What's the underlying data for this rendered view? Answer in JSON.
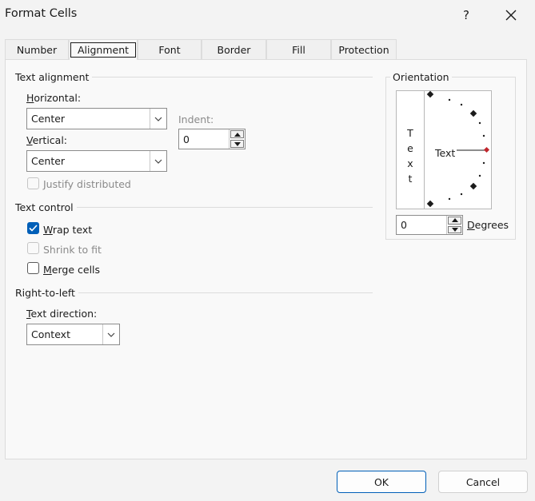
{
  "window": {
    "title": "Format Cells",
    "help_label": "?"
  },
  "tabs": [
    {
      "label": "Number",
      "active": false
    },
    {
      "label": "Alignment",
      "active": true
    },
    {
      "label": "Font",
      "active": false
    },
    {
      "label": "Border",
      "active": false
    },
    {
      "label": "Fill",
      "active": false
    },
    {
      "label": "Protection",
      "active": false
    }
  ],
  "text_alignment": {
    "group_label": "Text alignment",
    "horizontal_label_u": "H",
    "horizontal_label_rest": "orizontal:",
    "horizontal_value": "Center",
    "vertical_label_u": "V",
    "vertical_label_rest": "ertical:",
    "vertical_value": "Center",
    "indent_label": "Indent:",
    "indent_value": "0",
    "justify_distributed_label": "Justify distributed"
  },
  "text_control": {
    "group_label": "Text control",
    "wrap_text_u": "W",
    "wrap_text_rest": "rap text",
    "wrap_text_checked": true,
    "shrink_to_fit_label": "Shrink to fit",
    "merge_cells_u": "M",
    "merge_cells_rest": "erge cells",
    "merge_cells_checked": false
  },
  "right_to_left": {
    "group_label": "Right-to-left",
    "text_direction_u": "T",
    "text_direction_rest": "ext direction:",
    "text_direction_value": "Context"
  },
  "orientation": {
    "group_label": "Orientation",
    "vertical_text": [
      "T",
      "e",
      "x",
      "t"
    ],
    "dial_text": "Text",
    "degrees_value": "0",
    "degrees_u": "D",
    "degrees_rest": "egrees",
    "accent_color": "#c0262d"
  },
  "footer": {
    "ok_label": "OK",
    "cancel_label": "Cancel"
  },
  "colors": {
    "accent": "#005fb8",
    "disabled": "#8a8a8a"
  }
}
